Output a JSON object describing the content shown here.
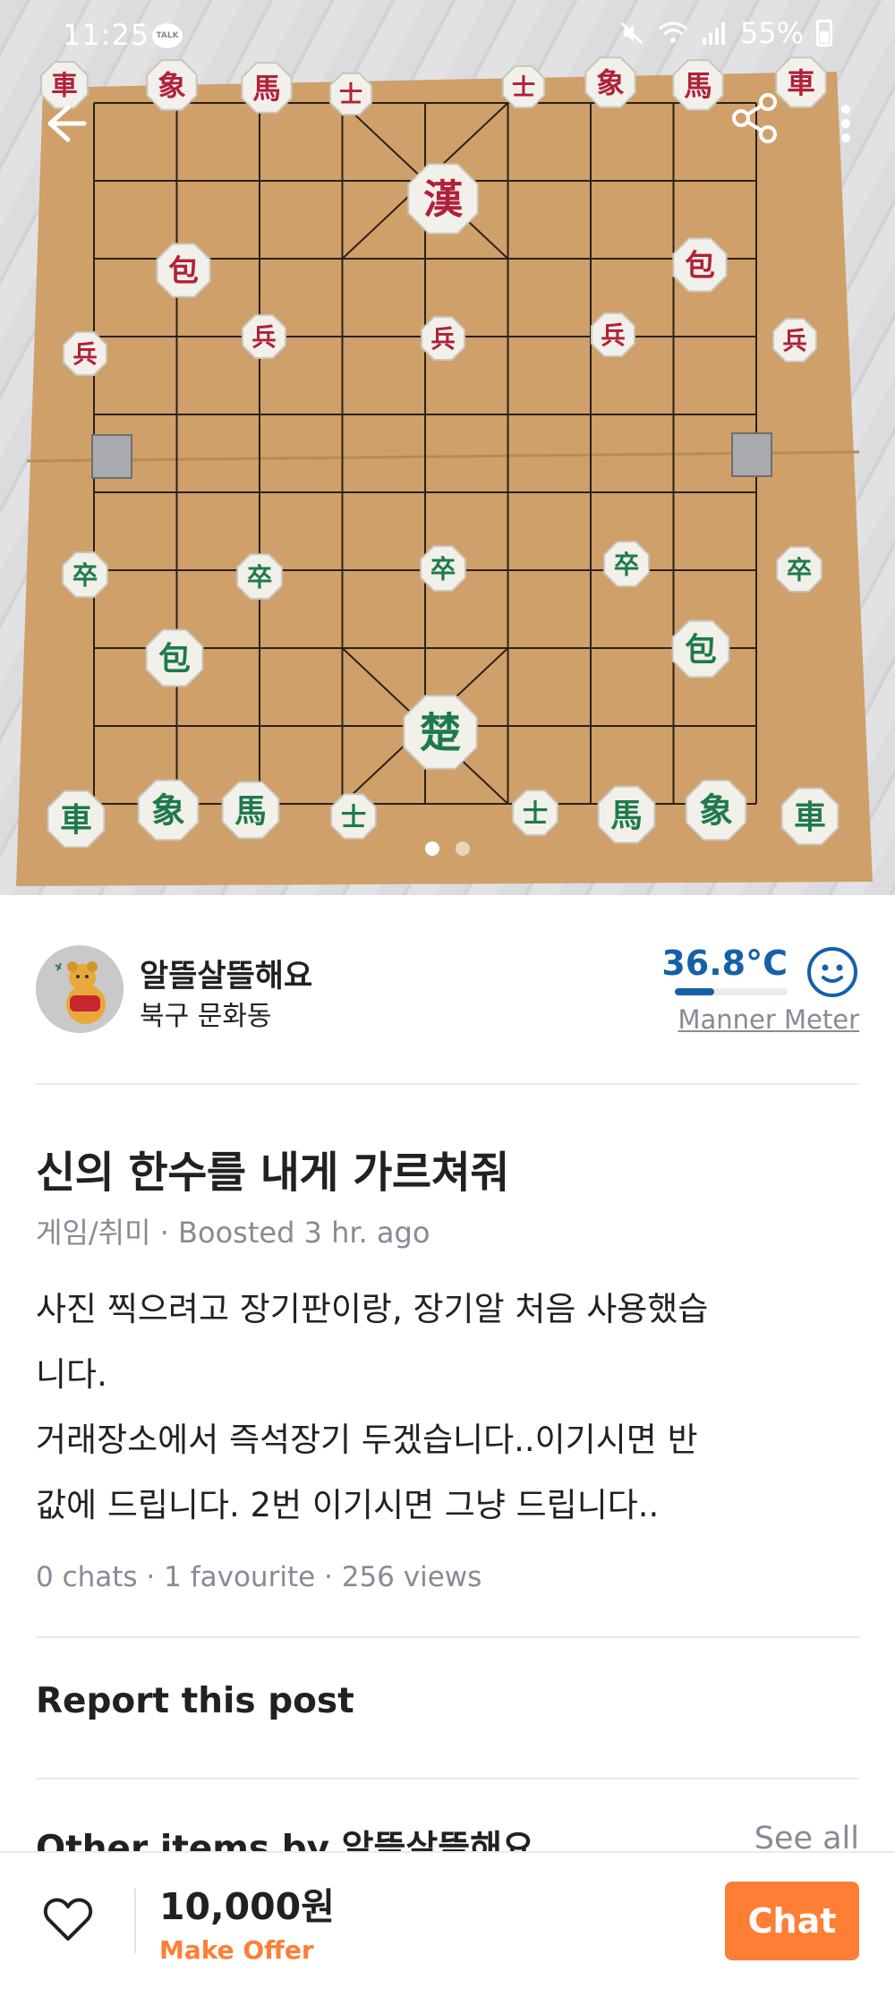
{
  "status_bar": {
    "time": "11:25",
    "talk_badge": "TALK",
    "battery": "55%"
  },
  "hero": {
    "page_count": 2,
    "active_page": 1,
    "red_pieces": [
      "車",
      "象",
      "馬",
      "士",
      "士",
      "象",
      "馬",
      "車",
      "漢",
      "包",
      "包",
      "兵",
      "兵",
      "兵",
      "兵",
      "兵"
    ],
    "green_pieces": [
      "卒",
      "卒",
      "卒",
      "卒",
      "卒",
      "包",
      "包",
      "楚",
      "車",
      "象",
      "馬",
      "士",
      "士",
      "馬",
      "象",
      "車"
    ]
  },
  "seller": {
    "name": "알뜰살뜰해요",
    "location": "북구 문화동",
    "manner_temp": "36.8°C",
    "manner_level": 0.35,
    "manner_label": "Manner Meter"
  },
  "post": {
    "title": "신의 한수를 내게 가르쳐줘",
    "meta": "게임/취미 · Boosted 3 hr. ago",
    "body_lines": [
      "사진 찍으려고 장기판이랑, 장기알 처음 사용했습",
      "니다.",
      "거래장소에서 즉석장기 두겠습니다..이기시면 반",
      "값에 드립니다. 2번 이기시면 그냥 드립니다.."
    ],
    "stats": "0 chats · 1 favourite · 256 views"
  },
  "report_label": "Report this post",
  "other_items": {
    "title": "Other items by 알뜰살뜰해요",
    "see_all": "See all"
  },
  "bottom_bar": {
    "price": "10,000원",
    "make_offer": "Make Offer",
    "chat_label": "Chat"
  },
  "colors": {
    "accent": "#ff7e36",
    "manner_blue": "#1561a9",
    "board": "#cfa06a",
    "red_piece_ink": "#b0213a",
    "green_piece_ink": "#1e7a4c"
  }
}
